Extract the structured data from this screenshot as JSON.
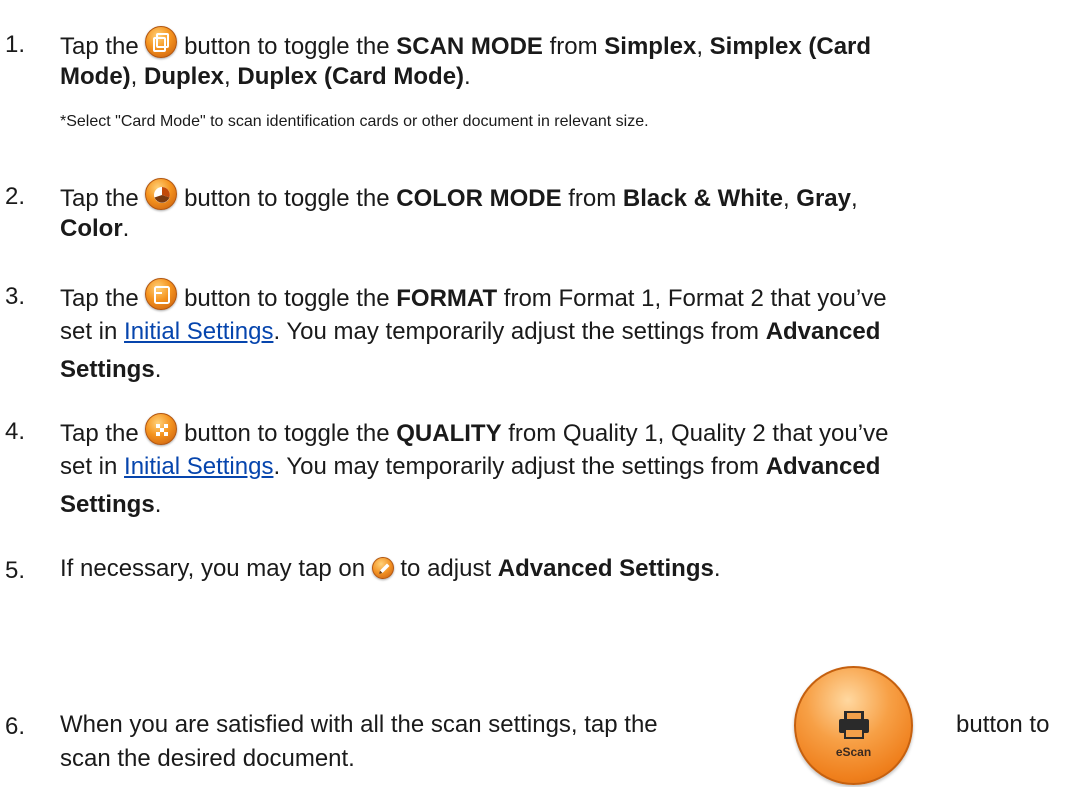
{
  "steps": [
    {
      "number": "1.",
      "line1": [
        "Tap the ",
        " button to toggle the ",
        "SCAN MODE",
        " from ",
        "Simplex",
        ", ",
        "Simplex (Card"
      ],
      "line2": [
        "Mode)",
        ", ",
        "Duplex",
        ", ",
        "Duplex (Card Mode)",
        "."
      ],
      "note": "*Select \"Card Mode\" to scan identification cards or other document in relevant size.",
      "icon": "scan-mode-icon"
    },
    {
      "number": "2.",
      "line1": [
        "Tap the ",
        " button to toggle the ",
        "COLOR MODE",
        " from ",
        "Black & White",
        ", ",
        "Gray",
        ","
      ],
      "line2": [
        "Color",
        "."
      ],
      "icon": "color-mode-icon"
    },
    {
      "number": "3.",
      "line1": [
        "Tap the ",
        " button to toggle the ",
        "FORMAT",
        " from Format 1, Format 2 that you’ve"
      ],
      "line2": [
        "set in ",
        "Initial Settings",
        ". You may temporarily adjust the settings from ",
        "Advanced"
      ],
      "line3": [
        "Settings",
        "."
      ],
      "icon": "format-icon"
    },
    {
      "number": "4.",
      "line1": [
        "Tap the ",
        " button to toggle the ",
        "QUALITY",
        " from Quality 1, Quality 2 that you’ve"
      ],
      "line2": [
        "set in ",
        "Initial Settings",
        ". You may temporarily adjust the settings from ",
        "Advanced"
      ],
      "line3": [
        "Settings",
        "."
      ],
      "icon": "quality-icon"
    },
    {
      "number": "5.",
      "line1": [
        "If necessary, you may tap on ",
        " to adjust ",
        "Advanced Settings",
        "."
      ],
      "icon": "edit-icon"
    },
    {
      "number": "6.",
      "line1": [
        "When you are satisfied with all the scan settings, tap the",
        "button to"
      ],
      "line2": [
        "scan the desired document."
      ],
      "escan_label": "eScan",
      "icon": "escan-printer-icon"
    }
  ],
  "colors": {
    "icon_orange": "#f5941f",
    "link_blue": "#0645ad"
  }
}
